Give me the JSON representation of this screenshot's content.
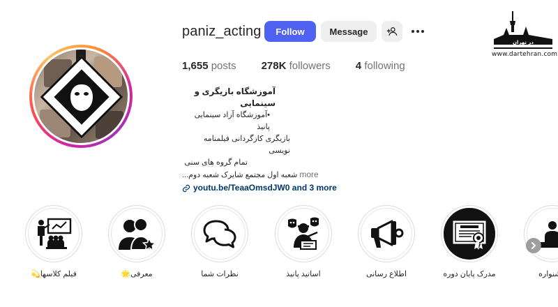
{
  "profile": {
    "username": "paniz_acting",
    "follow_label": "Follow",
    "message_label": "Message",
    "add_user_icon": "person-add-icon",
    "more_icon": "more-horizontal-icon"
  },
  "stats": {
    "posts_count": "1,655",
    "posts_label": "posts",
    "followers_count": "278K",
    "followers_label": "followers",
    "following_count": "4",
    "following_label": "following"
  },
  "bio": {
    "name": "آموزشگاه بازیگری و سینمایی",
    "line1": "•آموزشگاه آزاد سینمایی پانیذ",
    "line2": "بازیگری کارگردانی فیلمنامه نویسی",
    "line3": "تمام گروه های سنی",
    "line4": "شعبه اول مجتمع شایرک شعبه دوم...",
    "more_label": "more",
    "link_text": "youtu.be/TeaaOmsdJW0 and 3 more",
    "dots": ".."
  },
  "watermark": {
    "url_text": "www.dartehran.com",
    "logo_text": "در تهران"
  },
  "highlights": [
    {
      "label": "فیلم کلاسها💫",
      "icon": "classroom-presentation-icon"
    },
    {
      "label": "معرفی🌟",
      "icon": "people-star-icon"
    },
    {
      "label": "نظرات شما",
      "icon": "chat-bubbles-icon"
    },
    {
      "label": "اساتید پانیذ",
      "icon": "teacher-masks-icon"
    },
    {
      "label": "اطلاع رسانی",
      "icon": "megaphone-icon"
    },
    {
      "label": "مدرک پایان دوره",
      "icon": "certificate-icon"
    },
    {
      "label": "جشنواره",
      "icon": "podium-icon"
    }
  ],
  "colors": {
    "follow_button": "#4f63f0",
    "secondary_button": "#efefef",
    "link": "#00376b",
    "muted": "#737373"
  }
}
